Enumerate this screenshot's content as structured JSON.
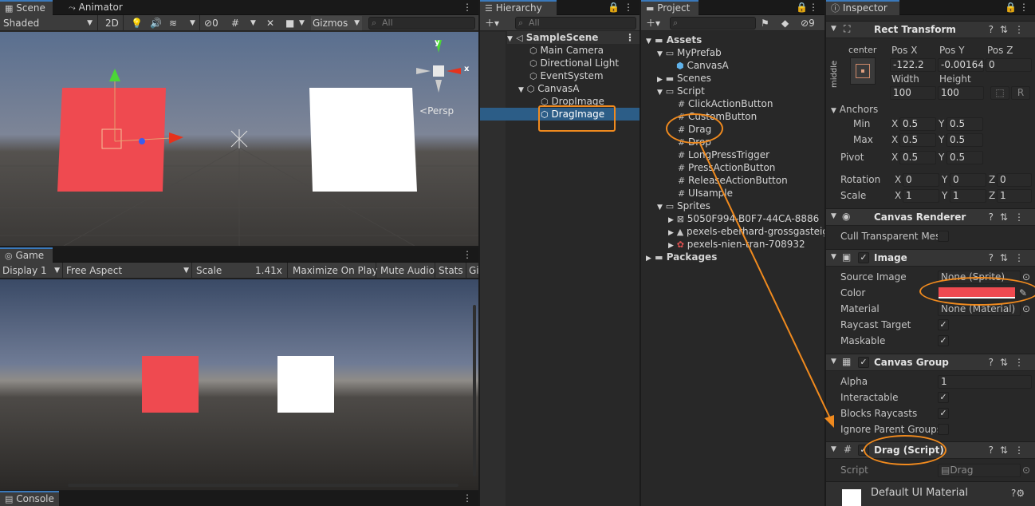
{
  "scene": {
    "tabs": [
      "Scene",
      "Animator"
    ],
    "shading": "Shaded",
    "mode_2d": "2D",
    "hidden_count": "0",
    "gizmos": "Gizmos",
    "search_placeholder": "All",
    "persp_label": "Persp",
    "axis_y": "y",
    "axis_x": "x"
  },
  "game": {
    "tab": "Game",
    "display": "Display 1",
    "aspect": "Free Aspect",
    "scale_label": "Scale",
    "scale_value": "1.41x",
    "maximize": "Maximize On Play",
    "mute": "Mute Audio",
    "stats": "Stats",
    "gizmos_short": "Gi"
  },
  "console": {
    "tab": "Console"
  },
  "hierarchy": {
    "tab": "Hierarchy",
    "search_placeholder": "All",
    "items": [
      {
        "label": "SampleScene",
        "icon": "unity-scene-icon"
      },
      {
        "label": "Main Camera",
        "icon": "gameobject-cube-icon"
      },
      {
        "label": "Directional Light",
        "icon": "gameobject-cube-icon"
      },
      {
        "label": "EventSystem",
        "icon": "gameobject-cube-icon"
      },
      {
        "label": "CanvasA",
        "icon": "gameobject-cube-icon"
      },
      {
        "label": "DropImage",
        "icon": "gameobject-cube-icon"
      },
      {
        "label": "DragImage",
        "icon": "gameobject-cube-icon"
      }
    ]
  },
  "project": {
    "tab": "Project",
    "hidden_count": "9",
    "items": [
      {
        "label": "Assets",
        "icon": "folder-icon"
      },
      {
        "label": "MyPrefab",
        "icon": "folder-icon"
      },
      {
        "label": "CanvasA",
        "icon": "prefab-cube-icon"
      },
      {
        "label": "Scenes",
        "icon": "folder-icon"
      },
      {
        "label": "Script",
        "icon": "folder-icon"
      },
      {
        "label": "ClickActionButton",
        "icon": "cs-script-icon"
      },
      {
        "label": "CustomButton",
        "icon": "cs-script-icon"
      },
      {
        "label": "Drag",
        "icon": "cs-script-icon"
      },
      {
        "label": "Drop",
        "icon": "cs-script-icon"
      },
      {
        "label": "LongPressTrigger",
        "icon": "cs-script-icon"
      },
      {
        "label": "PressActionButton",
        "icon": "cs-script-icon"
      },
      {
        "label": "ReleaseActionButton",
        "icon": "cs-script-icon"
      },
      {
        "label": "UIsample",
        "icon": "cs-script-icon"
      },
      {
        "label": "Sprites",
        "icon": "folder-icon"
      },
      {
        "label": "5050F994-B0F7-44CA-8886",
        "icon": "sprite-icon"
      },
      {
        "label": "pexels-eberhard-grossgasteig",
        "icon": "sprite-icon"
      },
      {
        "label": "pexels-nien-tran-708932",
        "icon": "sprite-icon"
      },
      {
        "label": "Packages",
        "icon": "folder-icon"
      }
    ]
  },
  "inspector": {
    "tab": "Inspector",
    "rect_transform": {
      "title": "Rect Transform",
      "anchor_h": "center",
      "anchor_v": "middle",
      "pos_x_label": "Pos X",
      "pos_y_label": "Pos Y",
      "pos_z_label": "Pos Z",
      "pos_x": "-122.2",
      "pos_y": "-0.00164",
      "pos_z": "0",
      "width_label": "Width",
      "height_label": "Height",
      "width": "100",
      "height": "100",
      "r_button": "R",
      "anchors_label": "Anchors",
      "min_label": "Min",
      "max_label": "Max",
      "min_x": "0.5",
      "min_y": "0.5",
      "max_x": "0.5",
      "max_y": "0.5",
      "pivot_label": "Pivot",
      "pivot_x": "0.5",
      "pivot_y": "0.5",
      "rotation_label": "Rotation",
      "rot_x": "0",
      "rot_y": "0",
      "rot_z": "0",
      "scale_label": "Scale",
      "scale_x": "1",
      "scale_y": "1",
      "scale_z": "1",
      "x": "X",
      "y": "Y",
      "z": "Z"
    },
    "canvas_renderer": {
      "title": "Canvas Renderer",
      "cull_label": "Cull Transparent Mes"
    },
    "image": {
      "title": "Image",
      "source_label": "Source Image",
      "source_value": "None (Sprite)",
      "color_label": "Color",
      "color_value": "#ef4a50",
      "material_label": "Material",
      "material_value": "None (Material)",
      "raycast_label": "Raycast Target",
      "maskable_label": "Maskable"
    },
    "canvas_group": {
      "title": "Canvas Group",
      "alpha_label": "Alpha",
      "alpha_value": "1",
      "interactable_label": "Interactable",
      "blocks_label": "Blocks Raycasts",
      "ignore_label": "Ignore Parent Groups"
    },
    "drag_script": {
      "title": "Drag (Script)",
      "script_label": "Script",
      "script_value": "Drag"
    },
    "material_footer": "Default UI Material"
  },
  "colors": {
    "accent": "#f08a1e",
    "selection": "#2c5d87",
    "red_image": "#ef4a50",
    "white_image": "#ffffff"
  }
}
